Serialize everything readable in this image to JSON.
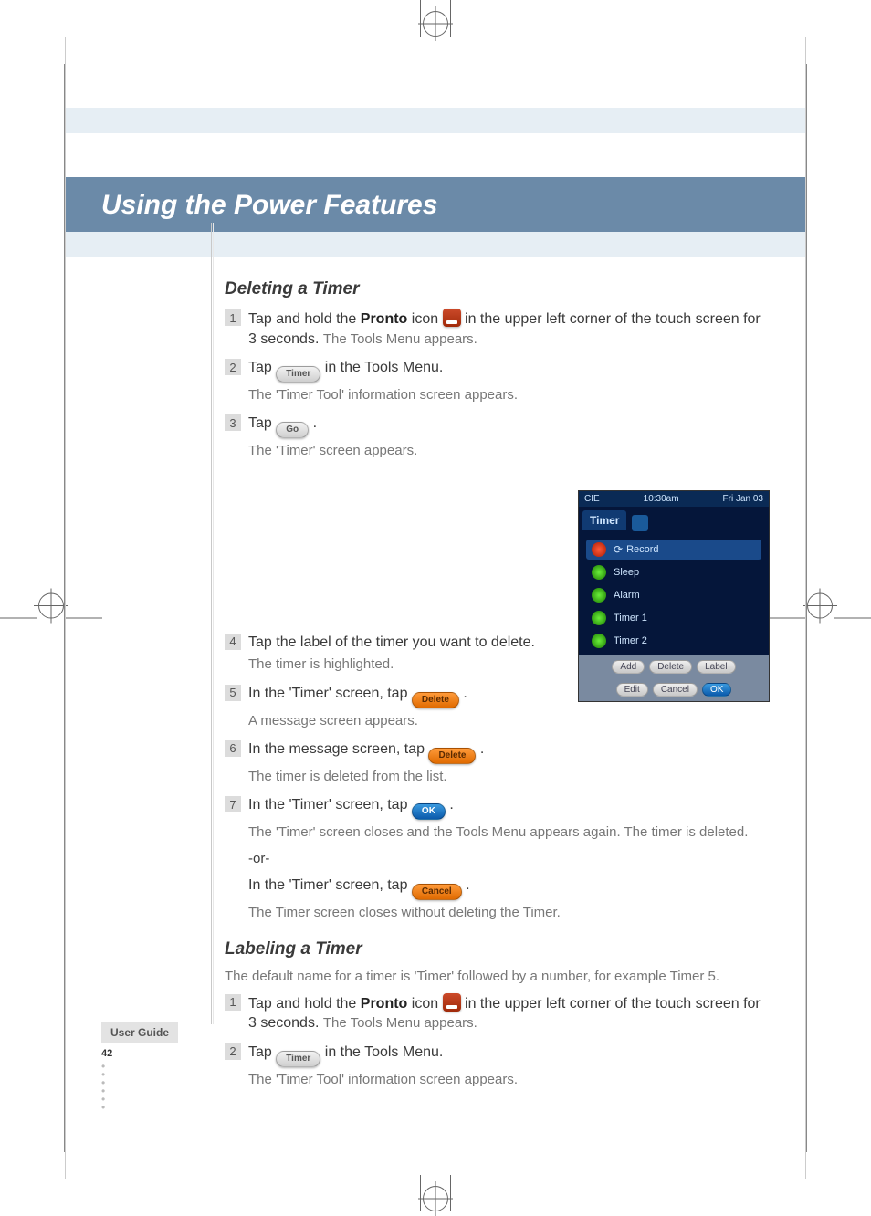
{
  "chapter_title": "Using the Power Features",
  "section_deleting": "Deleting a Timer",
  "steps_deleting": [
    {
      "num": "1",
      "pre": "Tap and hold the ",
      "bold": "Pronto",
      "mid": " icon ",
      "post": " in the upper left corner of the touch screen for 3 seconds.",
      "sub": "The Tools Menu appears."
    },
    {
      "num": "2",
      "pre": "Tap ",
      "post": " in the Tools Menu.",
      "sub": "The 'Timer Tool' information screen appears."
    },
    {
      "num": "3",
      "pre": "Tap ",
      "post": ".",
      "sub": "The 'Timer' screen appears."
    },
    {
      "num": "4",
      "pre": "Tap the label of the timer you want to delete.",
      "sub": "The timer is highlighted."
    },
    {
      "num": "5",
      "pre": "In the 'Timer' screen, tap ",
      "post": ".",
      "sub": "A message screen appears."
    },
    {
      "num": "6",
      "pre": "In the message screen, tap ",
      "post": ".",
      "sub": "The timer is deleted from the list."
    },
    {
      "num": "7",
      "pre": "In the 'Timer' screen, tap ",
      "post": ".",
      "sub": "The 'Timer' screen closes and the Tools Menu appears again. The timer is deleted."
    }
  ],
  "or_label": "-or-",
  "or_step": {
    "pre": "In the 'Timer' screen, tap ",
    "post": ".",
    "sub": "The Timer screen closes without deleting the Timer."
  },
  "section_labeling": "Labeling a Timer",
  "labeling_intro": "The default name for a timer is 'Timer' followed by a number, for example Timer 5.",
  "steps_labeling": [
    {
      "num": "1",
      "pre": "Tap and hold the ",
      "bold": "Pronto",
      "mid": " icon ",
      "post": " in the upper left corner of the touch screen for 3 seconds.",
      "sub": "The Tools Menu appears."
    },
    {
      "num": "2",
      "pre": "Tap ",
      "post": " in the Tools Menu.",
      "sub": "The 'Timer Tool' information screen appears."
    }
  ],
  "pills": {
    "timer": "Timer",
    "go": "Go",
    "delete": "Delete",
    "delete2": "Delete",
    "ok": "OK",
    "cancel": "Cancel"
  },
  "screenshot": {
    "top_left": "CIE",
    "top_center": "10:30am",
    "top_right": "Fri Jan 03",
    "tab": "Timer",
    "rows": [
      "Record",
      "Sleep",
      "Alarm",
      "Timer 1",
      "Timer 2"
    ],
    "btns_row1": [
      "Add",
      "Delete",
      "Label"
    ],
    "btns_row2": [
      "Edit",
      "Cancel",
      "OK"
    ]
  },
  "footer": {
    "label": "User Guide",
    "page": "42"
  }
}
